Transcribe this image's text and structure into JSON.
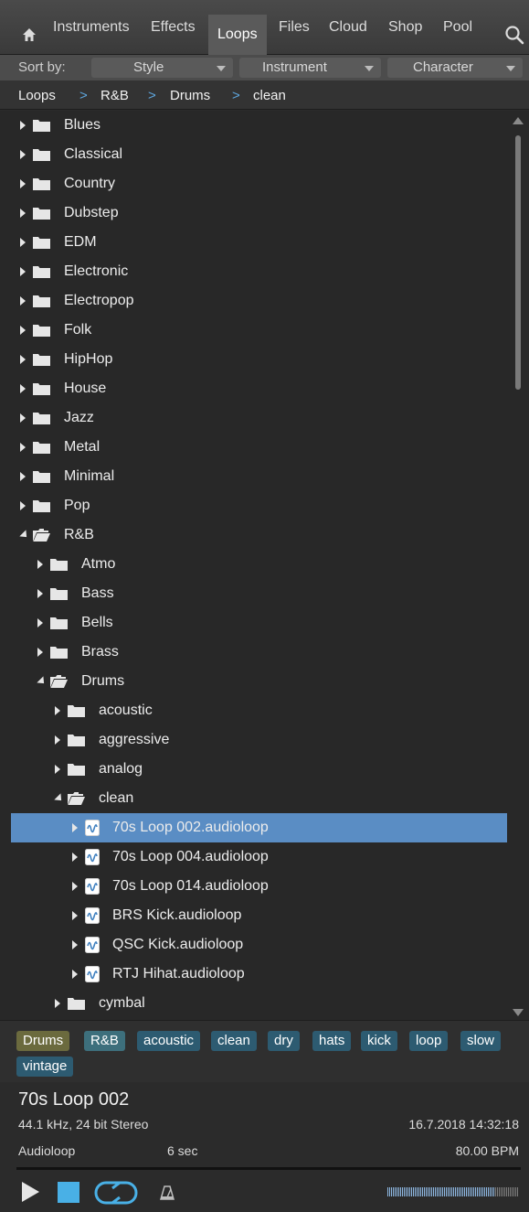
{
  "nav": {
    "tabs": [
      "Instruments",
      "Effects",
      "Loops",
      "Files",
      "Cloud",
      "Shop",
      "Pool"
    ],
    "active": "Loops",
    "icons": {
      "home": "home-icon",
      "search": "search-icon"
    }
  },
  "sortbar": {
    "label": "Sort by:",
    "options": [
      "Style",
      "Instrument",
      "Character"
    ]
  },
  "breadcrumb": [
    "Loops",
    "R&B",
    "Drums",
    "clean"
  ],
  "breadcrumb_separator": ">",
  "tree": {
    "rows": [
      {
        "label": "Blues",
        "state": "collapsed",
        "type": "folder"
      },
      {
        "label": "Classical",
        "state": "collapsed",
        "type": "folder"
      },
      {
        "label": "Country",
        "state": "collapsed",
        "type": "folder"
      },
      {
        "label": "Dubstep",
        "state": "collapsed",
        "type": "folder"
      },
      {
        "label": "EDM",
        "state": "collapsed",
        "type": "folder"
      },
      {
        "label": "Electronic",
        "state": "collapsed",
        "type": "folder"
      },
      {
        "label": "Electropop",
        "state": "collapsed",
        "type": "folder"
      },
      {
        "label": "Folk",
        "state": "collapsed",
        "type": "folder"
      },
      {
        "label": "HipHop",
        "state": "collapsed",
        "type": "folder"
      },
      {
        "label": "House",
        "state": "collapsed",
        "type": "folder"
      },
      {
        "label": "Jazz",
        "state": "collapsed",
        "type": "folder"
      },
      {
        "label": "Metal",
        "state": "collapsed",
        "type": "folder"
      },
      {
        "label": "Minimal",
        "state": "collapsed",
        "type": "folder"
      },
      {
        "label": "Pop",
        "state": "collapsed",
        "type": "folder"
      },
      {
        "label": "R&B",
        "state": "expanded",
        "type": "folder"
      },
      {
        "label": "Atmo",
        "state": "collapsed",
        "type": "folder"
      },
      {
        "label": "Bass",
        "state": "collapsed",
        "type": "folder"
      },
      {
        "label": "Bells",
        "state": "collapsed",
        "type": "folder"
      },
      {
        "label": "Brass",
        "state": "collapsed",
        "type": "folder"
      },
      {
        "label": "Drums",
        "state": "expanded",
        "type": "folder"
      },
      {
        "label": "acoustic",
        "state": "collapsed",
        "type": "folder"
      },
      {
        "label": "aggressive",
        "state": "collapsed",
        "type": "folder"
      },
      {
        "label": "analog",
        "state": "collapsed",
        "type": "folder"
      },
      {
        "label": "clean",
        "state": "expanded",
        "type": "folder"
      },
      {
        "label": "70s Loop 002.audioloop",
        "state": "collapsed",
        "type": "file",
        "selected": true
      },
      {
        "label": "70s Loop 004.audioloop",
        "state": "collapsed",
        "type": "file"
      },
      {
        "label": "70s Loop 014.audioloop",
        "state": "collapsed",
        "type": "file"
      },
      {
        "label": "BRS Kick.audioloop",
        "state": "collapsed",
        "type": "file"
      },
      {
        "label": "QSC Kick.audioloop",
        "state": "collapsed",
        "type": "file"
      },
      {
        "label": "RTJ Hihat.audioloop",
        "state": "collapsed",
        "type": "file"
      },
      {
        "label": "cymbal",
        "state": "collapsed",
        "type": "folder"
      }
    ]
  },
  "tags": [
    {
      "label": "Drums",
      "color": "#6b6a3e"
    },
    {
      "label": "R&B",
      "color": "#3d6f7c"
    },
    {
      "label": "acoustic",
      "color": "#2d5b71"
    },
    {
      "label": "clean",
      "color": "#2d5b71"
    },
    {
      "label": "dry",
      "color": "#2d5b71"
    },
    {
      "label": "hats",
      "color": "#2d5b71"
    },
    {
      "label": "kick",
      "color": "#2d5b71"
    },
    {
      "label": "loop",
      "color": "#2d5b71"
    },
    {
      "label": "slow",
      "color": "#2d5b71"
    },
    {
      "label": "vintage",
      "color": "#2d5b71"
    }
  ],
  "info": {
    "title": "70s Loop 002",
    "format": "44.1 kHz, 24 bit Stereo",
    "date": "16.7.2018 14:32:18",
    "type": "Audioloop",
    "duration": "6 sec",
    "bpm": "80.00 BPM"
  },
  "transport": {
    "icons": [
      "play-icon",
      "stop-icon",
      "loop-icon",
      "metronome-icon"
    ],
    "level": 0.82
  },
  "colors": {
    "accent": "#49b0e6",
    "selection": "#5a8dc4",
    "breadcrumb_separator": "#5ea6dd"
  }
}
